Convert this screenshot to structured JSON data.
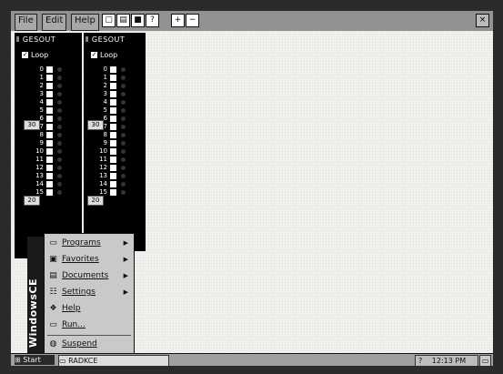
{
  "menubar": {
    "items": [
      "File",
      "Edit",
      "Help"
    ],
    "close_label": "×"
  },
  "toolbar": {
    "new_icon": "new-file-icon",
    "open_icon": "open-folder-icon",
    "save_icon": "save-disk-icon",
    "help_icon": "help-icon",
    "add_icon": "plus-icon",
    "remove_icon": "minus-icon"
  },
  "panels": [
    {
      "title": "GESOUT",
      "loop_label": "Loop",
      "loop_checked": true
    },
    {
      "title": "GESOUT",
      "loop_label": "Loop",
      "loop_checked": true
    }
  ],
  "channel_numbers": [
    "0",
    "1",
    "2",
    "3",
    "4",
    "5",
    "6",
    "7",
    "8",
    "9",
    "10",
    "11",
    "12",
    "13",
    "14",
    "15"
  ],
  "sliders": {
    "upper": "30",
    "lower": "20"
  },
  "side_band": {
    "text": "WindowsCE"
  },
  "start_menu": {
    "items": [
      {
        "label": "Programs",
        "icon": "programs-icon",
        "submenu": true
      },
      {
        "label": "Favorites",
        "icon": "favorites-icon",
        "submenu": true
      },
      {
        "label": "Documents",
        "icon": "documents-icon",
        "submenu": true
      },
      {
        "label": "Settings",
        "icon": "settings-icon",
        "submenu": true
      },
      {
        "label": "Help",
        "icon": "help-icon",
        "submenu": false
      },
      {
        "label": "Run...",
        "icon": "run-icon",
        "submenu": false
      },
      {
        "label": "Suspend",
        "icon": "suspend-icon",
        "submenu": false
      }
    ],
    "arrow": "▶"
  },
  "taskbar": {
    "start_label": "Start",
    "task_label": "RADKCE",
    "clock": "12:13 PM",
    "tray_help": "?",
    "desktop_icon": "desktop-icon"
  }
}
